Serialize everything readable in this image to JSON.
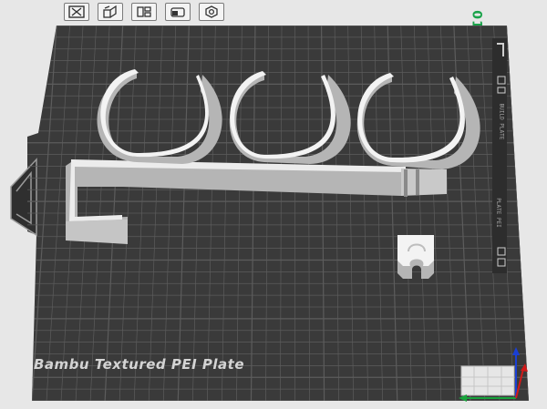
{
  "toolbar": {
    "buttons": [
      {
        "name": "close-plate-button",
        "icon": "close-icon"
      },
      {
        "name": "auto-orient-button",
        "icon": "orient-icon"
      },
      {
        "name": "arrange-button",
        "icon": "arrange-icon"
      },
      {
        "name": "lock-plate-button",
        "icon": "lock-icon"
      },
      {
        "name": "plate-settings-button",
        "icon": "gear-icon"
      }
    ]
  },
  "plate": {
    "number": "01",
    "label": "Bambu Textured PEI Plate",
    "side_text_1": "BUILD PLATE",
    "side_text_2": "PLATE PEI"
  },
  "colors": {
    "plate": "#3a3a3a",
    "grid": "#5c5c5c",
    "model": "#e1e1e1",
    "model_shadow": "#b5b5b5",
    "axis_x": "#d11a1a",
    "axis_y": "#19a33c",
    "axis_z": "#1a3fd4",
    "plate_number": "#1aa34a"
  }
}
